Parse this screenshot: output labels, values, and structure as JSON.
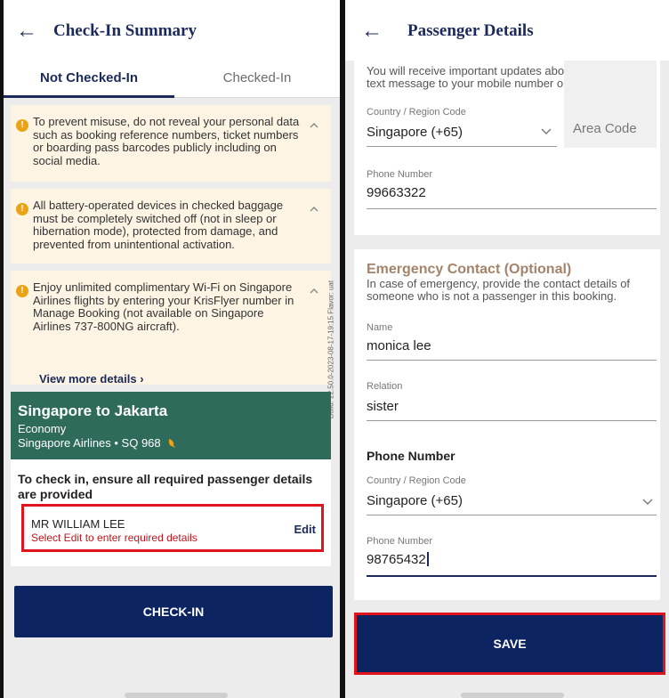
{
  "left": {
    "header": {
      "title": "Check-In Summary"
    },
    "tabs": [
      {
        "label": "Not Checked-In"
      },
      {
        "label": "Checked-In"
      }
    ],
    "notices": [
      {
        "text": "To prevent misuse, do not reveal your personal data such as booking reference numbers, ticket numbers or boarding pass barcodes publicly including on social media."
      },
      {
        "text": "All battery-operated devices in checked baggage must be completely switched off (not in sleep or hibernation mode), protected from damage, and prevented from unintentional activation."
      },
      {
        "text": "Enjoy unlimited complimentary Wi-Fi on Singapore Airlines flights by entering your KrisFlyer number in Manage Booking (not available on Singapore Airlines 737-800NG aircraft)."
      }
    ],
    "view_more": "View more details ›",
    "build_label": "Build: 22.50.0-2023-08-17-19:15  Flavor: uat",
    "flight_card": {
      "route": "Singapore to Jakarta",
      "cabin": "Economy",
      "flight": "Singapore Airlines • SQ 968",
      "ensure_text": "To check in, ensure all required passenger details are provided",
      "passenger": {
        "name": "MR WILLIAM LEE",
        "hint": "Select Edit to enter required details",
        "edit_label": "Edit"
      }
    },
    "checkin_button": "CHECK-IN"
  },
  "right": {
    "header": {
      "title": "Passenger Details"
    },
    "intro": "You will receive important updates about your flight via text message to your mobile number only.",
    "contact": {
      "country_label": "Country / Region Code",
      "country_value": "Singapore (+65)",
      "area_placeholder": "Area Code",
      "phone_label": "Phone Number",
      "phone_value": "99663322"
    },
    "emergency": {
      "title": "Emergency Contact (Optional)",
      "desc": "In case of emergency, provide the contact details of someone who is not a passenger in this booking.",
      "name_label": "Name",
      "name_value": "monica lee",
      "relation_label": "Relation",
      "relation_value": "sister",
      "phone_header": "Phone Number",
      "country_label": "Country / Region Code",
      "country_value": "Singapore (+65)",
      "phone_label": "Phone Number",
      "phone_value": "98765432"
    },
    "save_button": "SAVE"
  },
  "colors": {
    "navy": "#0c2461",
    "title_navy": "#1b2a5a",
    "notice_bg": "#fdf4e3",
    "warn": "#e8a317",
    "card_green": "#2e6b5b",
    "highlight_red": "#e0141c",
    "error_red": "#c0141c",
    "emergency_gold": "#a4836a"
  },
  "icons": [
    "back-arrow-icon",
    "warning-icon",
    "chevron-up-icon",
    "chevron-down-icon",
    "bird-logo-icon"
  ]
}
